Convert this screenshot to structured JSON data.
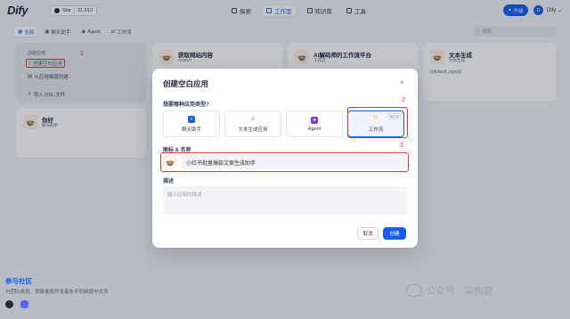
{
  "topbar": {
    "logo": "Dify",
    "github_label": "Star",
    "github_count": "21,613",
    "nav": [
      {
        "label": "探索",
        "active": false
      },
      {
        "label": "工作室",
        "active": true
      },
      {
        "label": "知识库",
        "active": false
      },
      {
        "label": "工具",
        "active": false
      }
    ],
    "upgrade_label": "升级",
    "avatar_letter": "D",
    "username": "Dify"
  },
  "filters": {
    "tabs": [
      "全部",
      "聊天助手",
      "Agent",
      "工作流"
    ],
    "active_index": 0,
    "search_placeholder": "搜索"
  },
  "create_card": {
    "title": "创建应用",
    "items": [
      "创建空白应用",
      "从应用模版创建",
      "导入 DSL 文件"
    ]
  },
  "apps": [
    {
      "name": "获取网站内容",
      "type": "AGENT",
      "desc": ""
    },
    {
      "name": "AI解码师的工作流平台",
      "type": "工作流",
      "desc": ""
    },
    {
      "name": "文本生成",
      "type": "文本生成",
      "desc": "{{default_input}}"
    },
    {
      "name": "你好",
      "type": "聊天助手",
      "desc": ""
    }
  ],
  "annotations": [
    "1",
    "2",
    "3"
  ],
  "modal": {
    "title": "创建空白应用",
    "close_icon": "×",
    "type_question": "想要哪种应用类型?",
    "types": [
      {
        "label": "聊天助手",
        "icon": "chat-icon",
        "color": "#155eef"
      },
      {
        "label": "文本生成应用",
        "icon": "text-gen-icon",
        "color": "#2e90fa"
      },
      {
        "label": "Agent",
        "icon": "agent-icon",
        "color": "#7839ee"
      },
      {
        "label": "工作流",
        "icon": "workflow-icon",
        "color": "#f79009",
        "badge": "BETA"
      }
    ],
    "selected_type": 3,
    "name_label": "图标 & 名称",
    "name_value": "小红书批量爆款文案生成助手",
    "desc_label": "描述",
    "desc_placeholder": "输入应用的描述",
    "cancel_label": "取消",
    "create_label": "创建"
  },
  "community": {
    "title": "参与社区",
    "desc": "与团队成员、贡献者和开发者在不同频道中交流"
  },
  "watermark": "公众号 · 架构营",
  "colors": {
    "primary": "#155eef",
    "highlight_red": "#e5322b"
  }
}
